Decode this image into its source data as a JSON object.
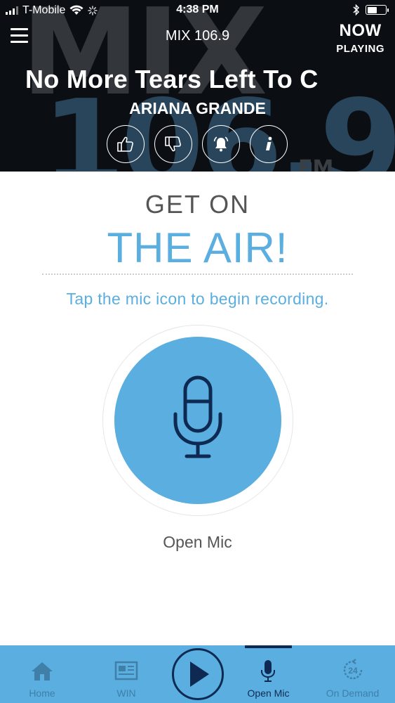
{
  "status_bar": {
    "carrier": "T-Mobile",
    "time": "4:38 PM"
  },
  "header": {
    "station_name": "MIX 106.9",
    "now_playing_line1": "NOW",
    "now_playing_line2": "PLAYING",
    "song_title": "No More Tears Left To C",
    "artist": "ARIANA GRANDE",
    "background_logo": {
      "line1": "MIX",
      "line2": "106.9",
      "line3": "FM"
    },
    "actions": [
      {
        "icon": "thumbs-up-icon"
      },
      {
        "icon": "thumbs-down-icon"
      },
      {
        "icon": "alarm-bell-icon"
      },
      {
        "icon": "info-icon"
      }
    ]
  },
  "main": {
    "heading_line1": "GET ON",
    "heading_line2": "THE AIR!",
    "instructions": "Tap the mic icon to begin recording.",
    "mic_label": "Open Mic"
  },
  "tabbar": {
    "tabs": [
      {
        "label": "Home",
        "icon": "home-icon",
        "active": false
      },
      {
        "label": "WIN",
        "icon": "news-icon",
        "active": false
      },
      {
        "label": "",
        "icon": "play-icon",
        "active": false
      },
      {
        "label": "Open Mic",
        "icon": "microphone-icon",
        "active": true
      },
      {
        "label": "On Demand",
        "icon": "on-demand-24-icon",
        "active": false
      }
    ]
  },
  "colors": {
    "accent": "#5aaee0",
    "dark_navy": "#0f2a52",
    "header_bg": "#0b0f14",
    "text_gray": "#555555"
  }
}
